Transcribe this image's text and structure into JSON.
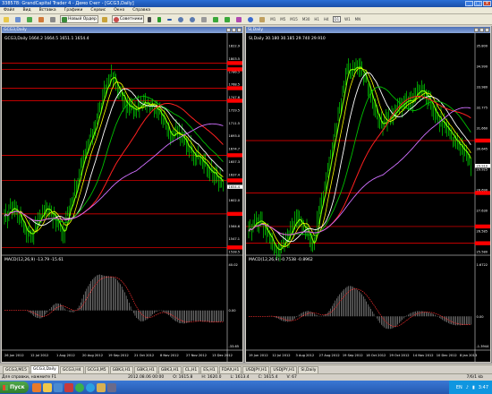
{
  "window": {
    "title": "338578: GrandCapital Trader 4 - Демо Счет - [GCG3,Daily]"
  },
  "menu": [
    "Файл",
    "Вид",
    "Вставка",
    "Графики",
    "Сервис",
    "Окно",
    "Справка"
  ],
  "toolbar": {
    "new_order": "Новый Ордер",
    "advisors": "Советники",
    "timeframes": [
      "M1",
      "M5",
      "M15",
      "M30",
      "H1",
      "H4",
      "D1",
      "W1",
      "MN"
    ],
    "active_timeframe": "D1"
  },
  "colors": {
    "chart_bg": "#000000",
    "bar_up": "#00ff00",
    "bar_down": "#00ff00",
    "hline": "#ff0000",
    "ma_yellow": "#ffff00",
    "ma_white": "#ffffff",
    "ma_green": "#00c000",
    "ma_lime": "#7cff00",
    "ma_red": "#ff2020",
    "ma_violet": "#d070ff",
    "macd_hist": "#c0c0c0",
    "macd_signal": "#ff3030"
  },
  "left_chart": {
    "caption": "GCG3,Daily",
    "info": "GCG3,Daily  1664.2 1664.5 1651.1 1654.4",
    "indicator": "MACD(12,26,9) -13.79 -15.61",
    "price_labels": [
      "1822.9",
      "1803.5",
      "1786.5",
      "1768.5",
      "1747.6",
      "1729.5",
      "1711.5",
      "1693.0",
      "1674.7",
      "1657.3",
      "1637.4",
      "1620.5",
      "1602.0",
      "1583.6",
      "1564.6",
      "1547.1",
      "1528.5"
    ],
    "current_price": "1654.4",
    "macd_labels": [
      "40.02",
      "0.00",
      "-33.65"
    ],
    "date_labels": [
      "26 Jun 2012",
      "12 Jul 2012",
      "1 Aug 2012",
      "20 Aug 2012",
      "19 Sep 2012",
      "21 Oct 2012",
      "8 Nov 2012",
      "27 Nov 2012",
      "13 Dec 2012"
    ]
  },
  "right_chart": {
    "caption": "SI,Daily",
    "info": "SI,Daily  30.180 30.185 29.740 29.910",
    "indicator": "MACD(12,26,9) -0.7538 -0.8962",
    "price_labels": [
      "35.800",
      "34.990",
      "33.980",
      "32.775",
      "31.660",
      "30.645",
      "29.925",
      "28.690",
      "27.630",
      "26.585",
      "25.580"
    ],
    "current_price": "29.910",
    "macd_labels": [
      "1.6722",
      "0.00",
      "-1.3944"
    ],
    "date_labels": [
      "19 Jun 2012",
      "12 Jul 2012",
      "3 Aug 2012",
      "27 Aug 2012",
      "19 Sep 2012",
      "18 Oct 2012",
      "29 Oct 2012",
      "14 Nov 2012",
      "10 Dec 2012",
      "8 Jan 2013"
    ]
  },
  "tabs": [
    "GCG3,M15",
    "GCG3,Daily",
    "GCG3,H4",
    "GCG3,M5",
    "GBK3,H1",
    "GBK3,H1",
    "GBK3,H1",
    "CL,H1",
    "ES,H1",
    "FDAX,H1",
    "USDJPY,H1",
    "USDJPY,H1",
    "SI,Daily"
  ],
  "active_tab": "GCG3,Daily",
  "status": {
    "help": "Для справки, нажмите F1",
    "time": "2012.08.06 00:00",
    "open": "O: 1615.8",
    "high": "H: 1620.0",
    "low": "L: 1613.4",
    "close": "C: 1615.4",
    "volume": "V: 67",
    "traffic": "7/6/1 kb"
  },
  "taskbar": {
    "start": "Пуск",
    "lang": "EN",
    "clock": "3:47"
  }
}
